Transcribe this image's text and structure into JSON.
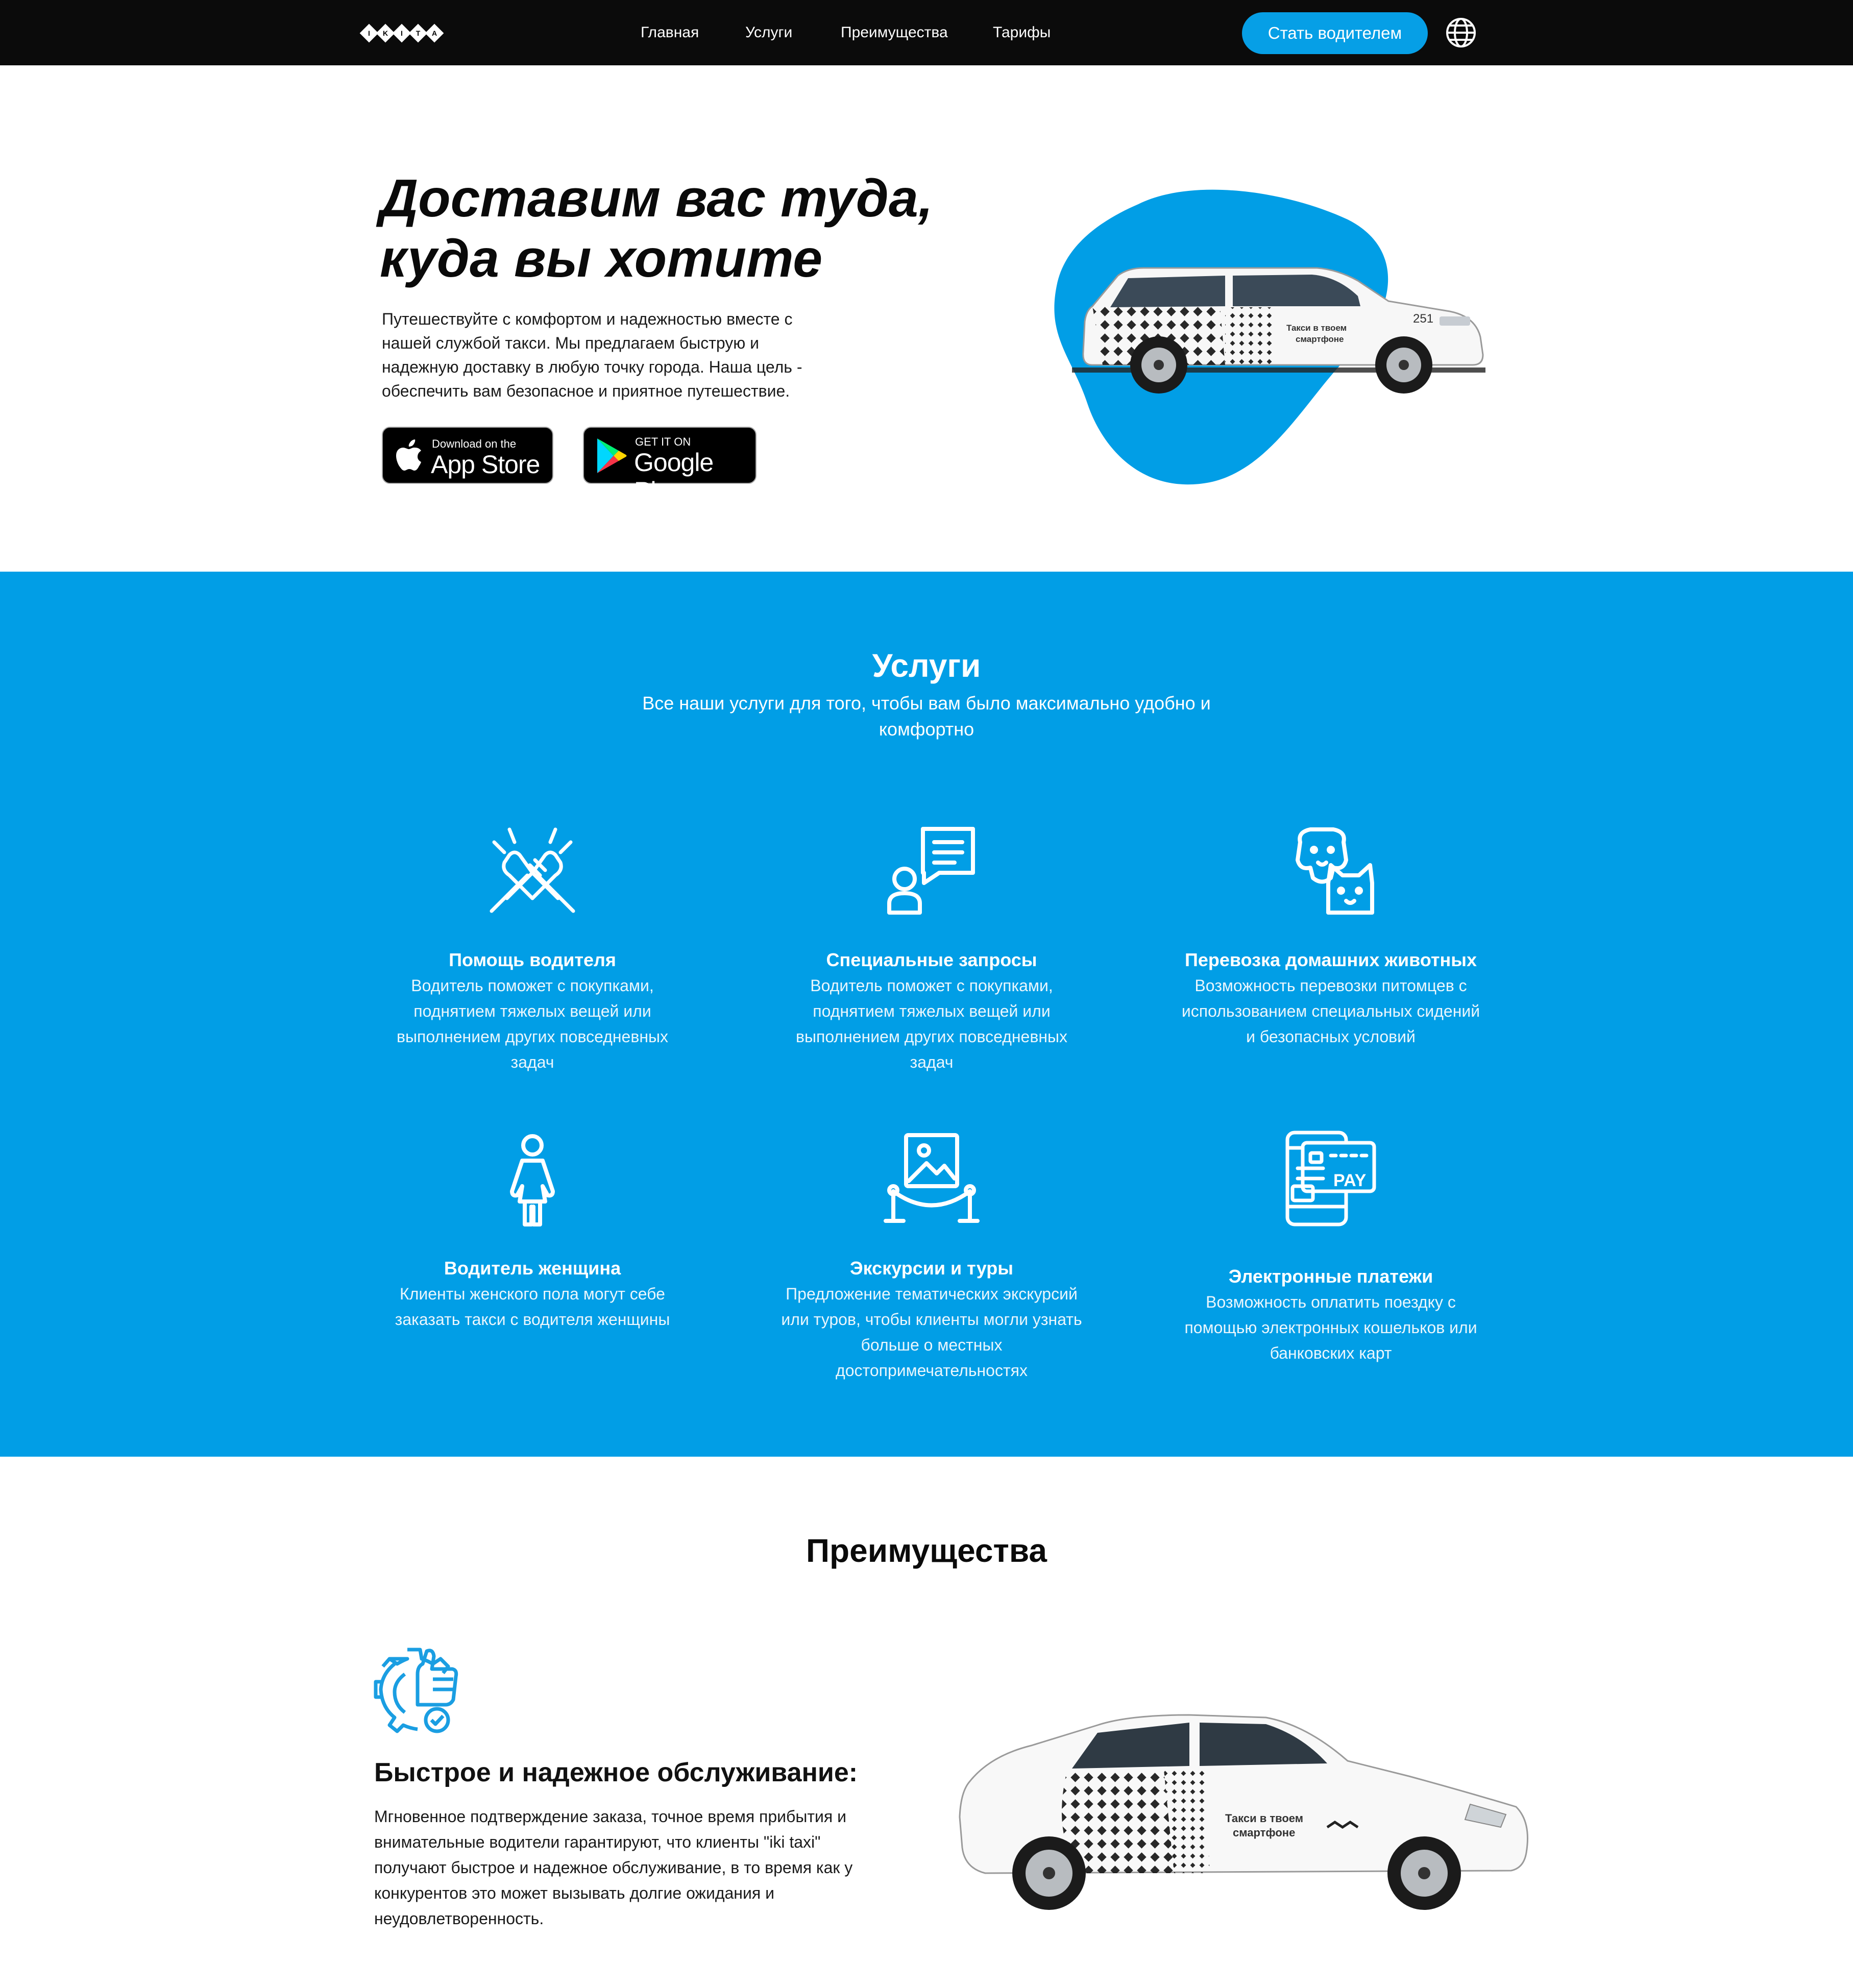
{
  "nav": {
    "logo_text": "IKI TAXI",
    "links": [
      "Главная",
      "Услуги",
      "Преимущества",
      "Тарифы"
    ],
    "cta": "Стать водителем",
    "language_icon": "globe-icon"
  },
  "hero": {
    "title_line1": "Доставим вас туда,",
    "title_line2": "куда вы хотите",
    "text": "Путешествуйте с комфортом и надежностью вместе с нашей службой такси. Мы предлагаем быструю и надежную доставку в любую точку города. Наша цель - обеспечить вам безопасное и приятное путешествие.",
    "appstore_small": "Download on the",
    "appstore_big": "App Store",
    "googleplay_small": "GET IT ON",
    "googleplay_big": "Google Play",
    "car_text_line1": "Такси в твоем",
    "car_text_line2": "смартфоне",
    "car_number": "251"
  },
  "services": {
    "title": "Услуги",
    "subtitle": "Все наши услуги для того, чтобы вам было максимально удобно и комфортно",
    "items": [
      {
        "icon": "handshake-icon",
        "title": "Помощь водителя",
        "desc": "Водитель поможет с покупками, поднятием тяжелых вещей или выполнением других повседневных задач"
      },
      {
        "icon": "chat-request-icon",
        "title": "Специальные запросы",
        "desc": "Водитель поможет с покупками, поднятием тяжелых вещей или выполнением других повседневных задач"
      },
      {
        "icon": "pets-icon",
        "title": "Перевозка домашних животных",
        "desc": "Возможность перевозки питомцев с использованием специальных сидений и безопасных условий"
      },
      {
        "icon": "woman-icon",
        "title": "Водитель женщина",
        "desc": "Клиенты женского пола могут себе заказать такси с водителя женщины"
      },
      {
        "icon": "excursion-icon",
        "title": "Экскурсии и туры",
        "desc": "Предложение тематических экскурсий или туров, чтобы клиенты могли узнать больше о местных достопримечательностях"
      },
      {
        "icon": "payment-icon",
        "title": "Электронные платежи",
        "desc": "Возможность оплатить поездку с помощью электронных кошельков или банковских карт",
        "pay_label": "PAY"
      }
    ]
  },
  "advantages": {
    "title": "Преимущества",
    "item": {
      "icon": "gear-thumbs-up-icon",
      "title": "Быстрое и надежное обслуживание:",
      "text": "Мгновенное подтверждение заказа, точное время прибытия и внимательные водители гарантируют, что клиенты \"iki taxi\" получают быстрое и надежное обслуживание, в то время как у конкурентов это может вызывать долгие ожидания и неудовлетворенность.",
      "car_text_line1": "Такси в твоем",
      "car_text_line2": "смартфоне"
    }
  },
  "colors": {
    "accent": "#019ee6",
    "nav_bg": "#0b0b0b",
    "cta": "#069fe6"
  }
}
